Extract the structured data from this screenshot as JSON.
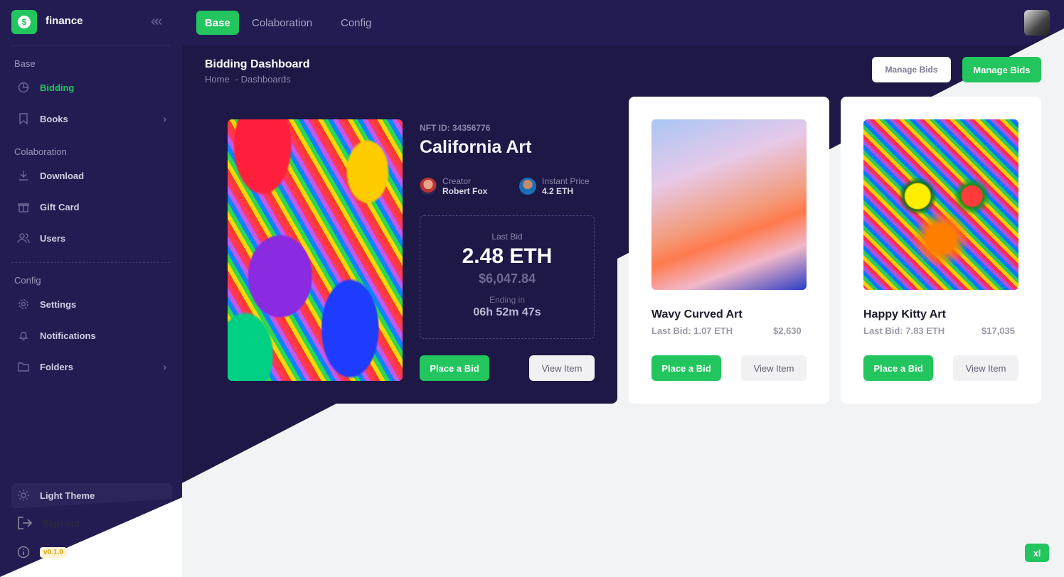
{
  "app": {
    "name": "finance",
    "logo_symbol": "$"
  },
  "topbar": {
    "tabs": [
      {
        "label": "Base"
      },
      {
        "label": "Colaboration"
      },
      {
        "label": "Config"
      }
    ]
  },
  "sidebar": {
    "sections": [
      {
        "title": "Base",
        "items": [
          {
            "label": "Bidding"
          },
          {
            "label": "Books"
          }
        ]
      },
      {
        "title": "Colaboration",
        "items": [
          {
            "label": "Download"
          },
          {
            "label": "Gift Card"
          },
          {
            "label": "Users"
          }
        ]
      },
      {
        "title": "Config",
        "items": [
          {
            "label": "Settings"
          },
          {
            "label": "Notifications"
          },
          {
            "label": "Folders"
          }
        ]
      }
    ],
    "theme_label": "Light Theme",
    "signout_label": "Sign out",
    "version": "v0.1.0"
  },
  "header": {
    "title": "Bidding Dashboard",
    "breadcrumb": [
      "Home",
      "- Dashboards"
    ],
    "manage_light_label": "Manage Bids",
    "manage_green_label": "Manage Bids"
  },
  "featured": {
    "nft_id": "NFT ID: 34356776",
    "title": "California Art",
    "creator_label": "Creator",
    "creator_name": "Robert Fox",
    "price_label": "Instant Price",
    "price_value": "4.2 ETH",
    "last_bid_label": "Last Bid",
    "last_bid_value": "2.48 ETH",
    "last_bid_usd": "$6,047.84",
    "ending_label": "Ending in",
    "ending_value": "06h 52m 47s",
    "bid_button": "Place a Bid",
    "view_button": "View Item"
  },
  "cards": [
    {
      "title": "Wavy Curved Art",
      "last_bid": "Last Bid: 1.07 ETH",
      "price": "$2,630",
      "bid_button": "Place a Bid",
      "view_button": "View Item"
    },
    {
      "title": "Happy Kitty Art",
      "last_bid": "Last Bid: 7.83 ETH",
      "price": "$17,035",
      "bid_button": "Place a Bid",
      "view_button": "View Item"
    }
  ],
  "breakpoint_badge": "xl",
  "colors": {
    "accent": "#22c55e",
    "dark": "#1d1846",
    "sidebar": "#221c52"
  }
}
